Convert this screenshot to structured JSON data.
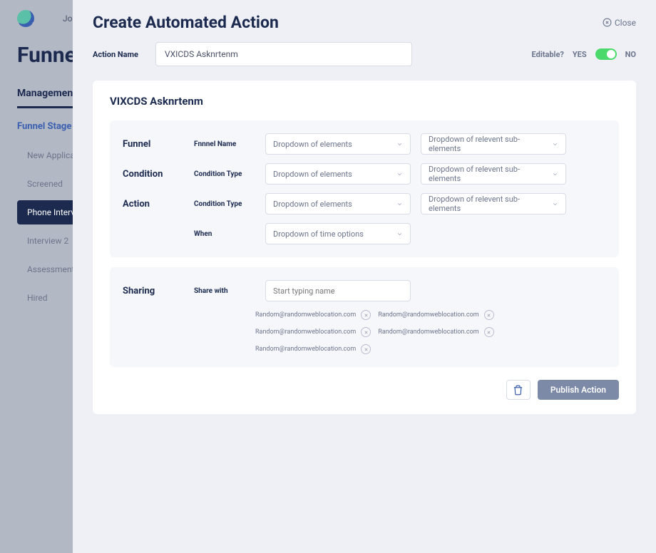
{
  "background": {
    "nav_item": "Jo",
    "title": "Funnels",
    "tab": "Management",
    "section": "Funnel Stage",
    "stages": [
      "New Applicant",
      "Screened",
      "Phone Interview",
      "Interview 2",
      "Assessment D",
      "Hired"
    ],
    "active_stage_index": 2
  },
  "modal": {
    "title": "Create Automated Action",
    "close_label": "Close",
    "action_name_label": "Action Name",
    "action_name_value": "VXICDS Asknrtenm",
    "editable_label": "Editable?",
    "yes": "YES",
    "no": "NO"
  },
  "card": {
    "title": "VIXCDS Asknrtenm",
    "rows": [
      {
        "section": "Funnel",
        "sub": "Fnnnel Name",
        "dd1": "Dropdown of elements",
        "dd2": "Dropdown of relevent sub-elements"
      },
      {
        "section": "Condition",
        "sub": "Condition Type",
        "dd1": "Dropdown of elements",
        "dd2": "Dropdown of relevent sub-elements"
      },
      {
        "section": "Action",
        "sub": "Condition Type",
        "dd1": "Dropdown of elements",
        "dd2": "Dropdown of relevent sub-elements"
      },
      {
        "section": "",
        "sub": "When",
        "dd1": "Dropdown of time options",
        "dd2": ""
      }
    ],
    "sharing_label": "Sharing",
    "share_with_label": "Share with",
    "share_placeholder": "Start typing name",
    "chips": [
      "Random@randomweblocation.com",
      "Random@randomweblocation.com",
      "Random@randomweblocation.com",
      "Random@randomweblocation.com",
      "Random@randomweblocation.com"
    ],
    "publish_label": "Publish Action"
  }
}
